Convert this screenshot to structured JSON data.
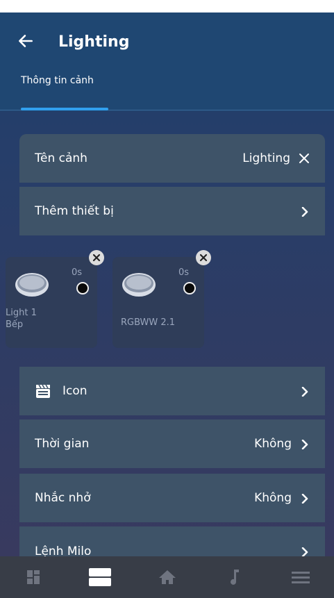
{
  "header": {
    "title": "Lighting"
  },
  "tabs": [
    {
      "label": "Thông tin cảnh"
    }
  ],
  "scene_name": {
    "label": "Tên cảnh",
    "value": "Lighting"
  },
  "add_device": {
    "label": "Thêm thiết bị"
  },
  "devices": [
    {
      "delay": "0s",
      "name": "Light 1",
      "room": "Bếp"
    },
    {
      "delay": "0s",
      "name": "RGBWW 2.1",
      "room": ""
    }
  ],
  "icon_row": {
    "label": "Icon"
  },
  "time_row": {
    "label": "Thời gian",
    "value": "Không"
  },
  "reminder_row": {
    "label": "Nhắc nhở",
    "value": "Không"
  },
  "milo_row": {
    "label": "Lệnh Milo"
  },
  "bottom_nav": [
    {
      "icon": "dashboard-icon"
    },
    {
      "icon": "scenes-icon"
    },
    {
      "icon": "home-icon"
    },
    {
      "icon": "music-note-icon"
    },
    {
      "icon": "menu-icon"
    }
  ],
  "colors": {
    "header": "#1f4772",
    "accent": "#31a0ee",
    "row": "#3e5368",
    "card": "#2f3d59",
    "nav": "#383d47"
  }
}
